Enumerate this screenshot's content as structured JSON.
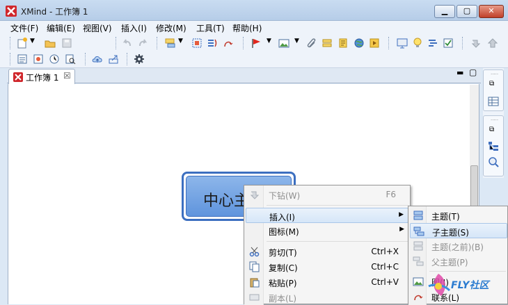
{
  "window": {
    "title": "XMind - 工作簿 1"
  },
  "menubar": [
    {
      "label": "文件(F)"
    },
    {
      "label": "编辑(E)"
    },
    {
      "label": "视图(V)"
    },
    {
      "label": "插入(I)"
    },
    {
      "label": "修改(M)"
    },
    {
      "label": "工具(T)"
    },
    {
      "label": "帮助(H)"
    }
  ],
  "tab": {
    "label": "工作簿 1",
    "close": "☒"
  },
  "topic": {
    "text": "中心主"
  },
  "context_menu": [
    {
      "label": "下钻(W)",
      "shortcut": "F6",
      "disabled": true
    },
    {
      "label": "插入(I)",
      "submenu": true
    },
    {
      "label": "图标(M)",
      "submenu": true
    },
    {
      "label": "剪切(T)",
      "shortcut": "Ctrl+X"
    },
    {
      "label": "复制(C)",
      "shortcut": "Ctrl+C"
    },
    {
      "label": "粘贴(P)",
      "shortcut": "Ctrl+V"
    },
    {
      "label": "副本(L)",
      "disabled": true
    }
  ],
  "submenu": [
    {
      "label": "主题(T)"
    },
    {
      "label": "子主题(S)"
    },
    {
      "label": "主题(之前)(B)",
      "disabled": true
    },
    {
      "label": "父主题(P)",
      "disabled": true
    },
    {
      "label": "图(I)"
    },
    {
      "label": "联系(L)"
    }
  ],
  "watermark": {
    "text": "FLY社区"
  }
}
